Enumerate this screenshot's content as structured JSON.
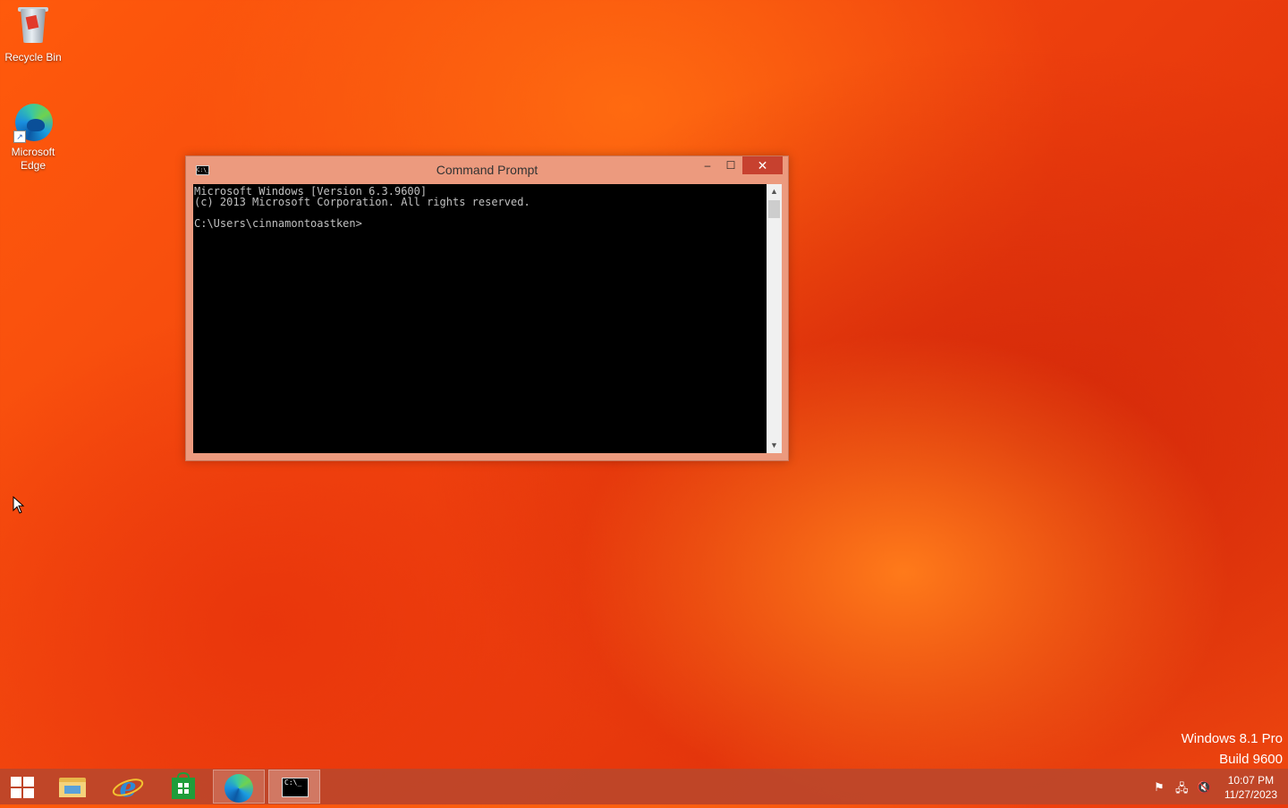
{
  "desktop": {
    "icons": [
      {
        "label": "Recycle Bin"
      },
      {
        "label": "Microsoft Edge"
      }
    ],
    "watermark": {
      "line1": "Windows 8.1 Pro",
      "line2": "Build 9600"
    }
  },
  "window": {
    "title": "Command Prompt",
    "icon_text": "C:\\_",
    "buttons": {
      "minimize": "–",
      "maximize": "☐",
      "close": "✕"
    },
    "console_lines": [
      "Microsoft Windows [Version 6.3.9600]",
      "(c) 2013 Microsoft Corporation. All rights reserved.",
      "",
      "C:\\Users\\cinnamontoastken>"
    ]
  },
  "taskbar": {
    "items": [
      "start",
      "file-explorer",
      "internet-explorer",
      "store",
      "microsoft-edge",
      "command-prompt"
    ],
    "active_item": "command-prompt",
    "cmd_icon_text": "C:\\_",
    "clock": {
      "time": "10:07 PM",
      "date": "11/27/2023"
    }
  },
  "colors": {
    "accent": "#ec9a7e",
    "close": "#c7412f",
    "taskbar": "#bc462a"
  }
}
